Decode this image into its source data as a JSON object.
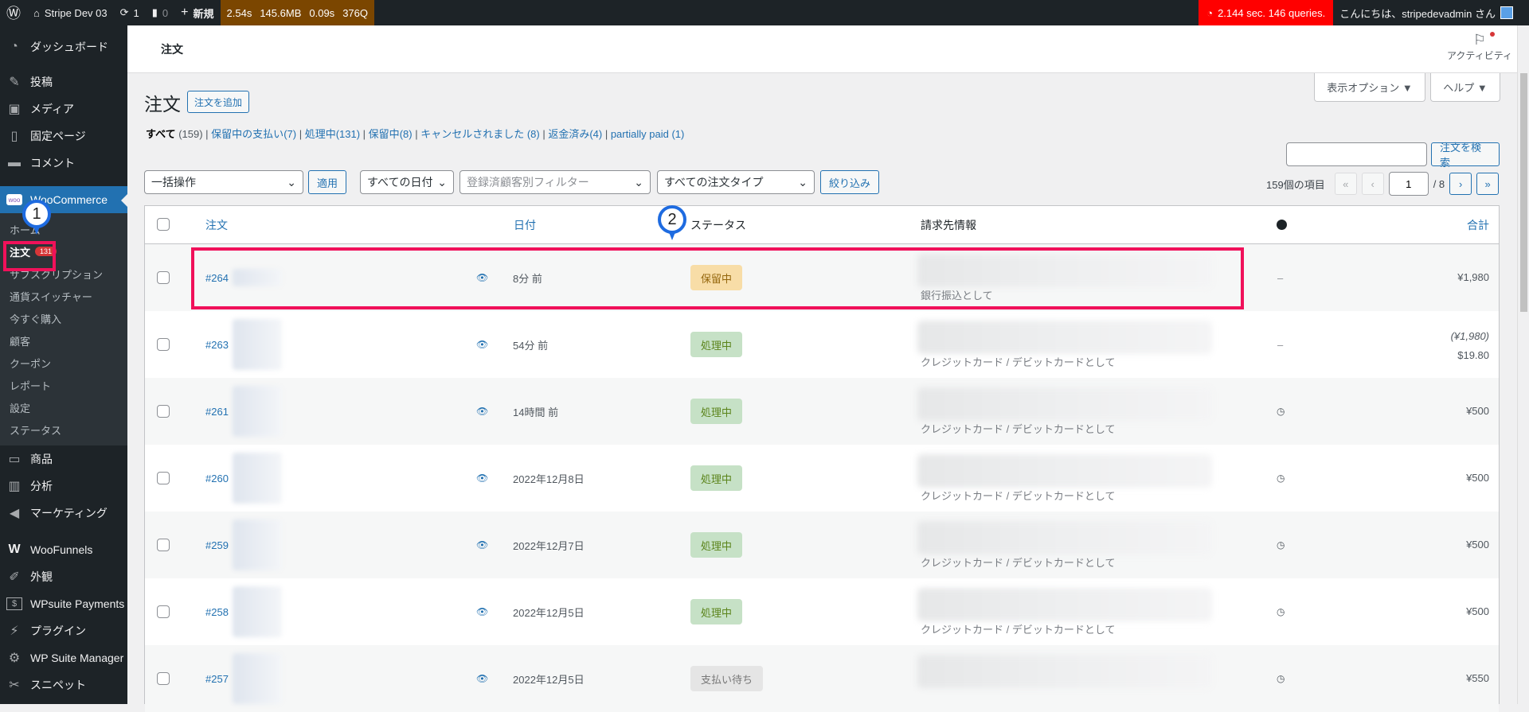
{
  "adminbar": {
    "site_name": "Stripe Dev 03",
    "updates": "1",
    "comments": "0",
    "new_label": "新規",
    "qm": [
      "2.54s",
      "145.6MB",
      "0.09s",
      "376Q"
    ],
    "perf": "2.144 sec. 146 queries.",
    "greeting": "こんにちは、stripedevadmin さん"
  },
  "sidebar": {
    "top": [
      {
        "label": "ダッシュボード",
        "icon": "dashboard-icon"
      }
    ],
    "items": [
      {
        "label": "投稿",
        "icon": "pin-icon"
      },
      {
        "label": "メディア",
        "icon": "media-icon"
      },
      {
        "label": "固定ページ",
        "icon": "page-icon"
      },
      {
        "label": "コメント",
        "icon": "comment-icon"
      }
    ],
    "woo": {
      "label": "WooCommerce",
      "icon": "woo-icon"
    },
    "woo_sub": [
      {
        "label": "ホーム"
      },
      {
        "label": "注文",
        "badge": "131"
      },
      {
        "label": "サブスクリプション"
      },
      {
        "label": "通貨スイッチャー"
      },
      {
        "label": "今すぐ購入"
      },
      {
        "label": "顧客"
      },
      {
        "label": "クーポン"
      },
      {
        "label": "レポート"
      },
      {
        "label": "設定"
      },
      {
        "label": "ステータス"
      }
    ],
    "bottom": [
      {
        "label": "商品",
        "icon": "archive-icon"
      },
      {
        "label": "分析",
        "icon": "chart-icon"
      },
      {
        "label": "マーケティング",
        "icon": "megaphone-icon"
      },
      {
        "label": "WooFunnels",
        "icon": "woofunnels-icon"
      },
      {
        "label": "外観",
        "icon": "brush-icon"
      },
      {
        "label": "WPsuite Payments",
        "icon": "dollar-icon"
      },
      {
        "label": "プラグイン",
        "icon": "plugin-icon"
      },
      {
        "label": "WP Suite Manager",
        "icon": "gear-icon"
      },
      {
        "label": "スニペット",
        "icon": "scissors-icon"
      }
    ]
  },
  "header": {
    "title": "注文",
    "activity": "アクティビティ"
  },
  "screen_options": "表示オプション ▼",
  "help": "ヘルプ ▼",
  "page": {
    "title": "注文",
    "add_button": "注文を追加"
  },
  "views": [
    {
      "label": "すべて",
      "count": "(159)",
      "current": true
    },
    {
      "label": "保留中の支払い",
      "count": "(7)"
    },
    {
      "label": "処理中",
      "count": "(131)"
    },
    {
      "label": "保留中",
      "count": "(8)"
    },
    {
      "label": "キャンセルされました",
      "count": " (8)"
    },
    {
      "label": "返金済み",
      "count": "(4)"
    },
    {
      "label": "partially paid",
      "count": " (1)"
    }
  ],
  "search": {
    "value": "",
    "button": "注文を検索"
  },
  "filters": {
    "bulk": "一括操作",
    "apply": "適用",
    "dates": "すべての日付",
    "customer_placeholder": "登録済顧客別フィルター",
    "order_type": "すべての注文タイプ",
    "filter": "絞り込み"
  },
  "pagination": {
    "items": "159個の項目",
    "first": "«",
    "prev": "‹",
    "current": "1",
    "total": "/ 8",
    "next": "›",
    "last": "»"
  },
  "table": {
    "headers": {
      "order": "注文",
      "date": "日付",
      "status": "ステータス",
      "billing": "請求先情報",
      "total": "合計"
    },
    "rows": [
      {
        "order": "#264",
        "date": "8分 前",
        "status": "保留中",
        "status_type": "on-hold",
        "payment": "銀行振込として",
        "origin": "–",
        "total": "¥1,980",
        "total2": ""
      },
      {
        "order": "#263",
        "date": "54分 前",
        "status": "処理中",
        "status_type": "processing",
        "payment": "クレジットカード / デビットカードとして",
        "origin": "–",
        "total": "(¥1,980)",
        "total2": "$19.80"
      },
      {
        "order": "#261",
        "date": "14時間 前",
        "status": "処理中",
        "status_type": "processing",
        "payment": "クレジットカード / デビットカードとして",
        "origin": "history",
        "total": "¥500",
        "total2": ""
      },
      {
        "order": "#260",
        "date": "2022年12月8日",
        "status": "処理中",
        "status_type": "processing",
        "payment": "クレジットカード / デビットカードとして",
        "origin": "history",
        "total": "¥500",
        "total2": ""
      },
      {
        "order": "#259",
        "date": "2022年12月7日",
        "status": "処理中",
        "status_type": "processing",
        "payment": "クレジットカード / デビットカードとして",
        "origin": "history",
        "total": "¥500",
        "total2": ""
      },
      {
        "order": "#258",
        "date": "2022年12月5日",
        "status": "処理中",
        "status_type": "processing",
        "payment": "クレジットカード / デビットカードとして",
        "origin": "history",
        "total": "¥500",
        "total2": ""
      },
      {
        "order": "#257",
        "date": "2022年12月5日",
        "status": "支払い待ち",
        "status_type": "pending",
        "payment": "",
        "origin": "history",
        "total": "¥550",
        "total2": ""
      }
    ]
  },
  "callouts": [
    "1",
    "2"
  ],
  "colors": {
    "accent": "#2271b1",
    "highlight": "#f0115a",
    "callout": "#1e6be0",
    "on_hold_bg": "#f8dda7",
    "processing_bg": "#c6e1c6",
    "pending_bg": "#e5e5e5"
  }
}
